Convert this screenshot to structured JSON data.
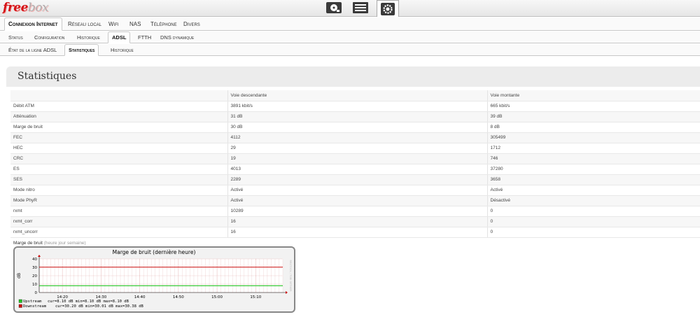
{
  "app": {
    "logo_main": "free",
    "logo_suffix": "box"
  },
  "top_icons": [
    "download-icon",
    "list-icon",
    "settings-icon"
  ],
  "tabs_level1": [
    {
      "label": "Connexion Internet",
      "active": true
    },
    {
      "label": "Réseau local",
      "active": false
    },
    {
      "label": "Wifi",
      "active": false
    },
    {
      "label": "NAS",
      "active": false
    },
    {
      "label": "Téléphone",
      "active": false
    },
    {
      "label": "Divers",
      "active": false
    }
  ],
  "tabs_level2": [
    {
      "label": "Status",
      "active": false
    },
    {
      "label": "Configuration",
      "active": false
    },
    {
      "label": "Historique",
      "active": false
    },
    {
      "label": "ADSL",
      "active": true
    },
    {
      "label": "FTTH",
      "active": false
    },
    {
      "label": "DNS dynamique",
      "active": false
    }
  ],
  "tabs_level3": [
    {
      "label": "État de la ligne ADSL",
      "active": false
    },
    {
      "label": "Statistiques",
      "active": true
    },
    {
      "label": "Historique",
      "active": false
    }
  ],
  "panel": {
    "title": "Statistiques"
  },
  "stats": {
    "headers": [
      "",
      "Voie descendante",
      "Voie montante"
    ],
    "rows": [
      [
        "Débit ATM",
        "3891 kbit/s",
        "665 kbit/s"
      ],
      [
        "Atténuation",
        "31 dB",
        "39 dB"
      ],
      [
        "Marge de bruit",
        "30 dB",
        "8 dB"
      ],
      [
        "FEC",
        "4112",
        "305499"
      ],
      [
        "HEC",
        "29",
        "1712"
      ],
      [
        "CRC",
        "19",
        "746"
      ],
      [
        "ES",
        "4013",
        "37280"
      ],
      [
        "SES",
        "2289",
        "3658"
      ],
      [
        "Mode nitro",
        "Activé",
        "Activé"
      ],
      [
        "Mode PhyR",
        "Activé",
        "Désactivé"
      ],
      [
        "rxmt",
        "10289",
        "0"
      ],
      [
        "rxmt_corr",
        "16",
        "0"
      ],
      [
        "rxmt_uncorr",
        "16",
        "0"
      ]
    ]
  },
  "graph": {
    "label": "Marge de bruit",
    "label_links": "(heure jour semaine)",
    "watermark": "RRDTOOL / TOBI OETIKER"
  },
  "chart_data": {
    "type": "line",
    "title": "Marge de bruit (dernière heure)",
    "ylabel": "dB",
    "ylim": [
      0,
      40
    ],
    "yticks": [
      "0",
      "10",
      "20",
      "30",
      "40"
    ],
    "xlim": [
      "14:14",
      "15:17"
    ],
    "xticks": [
      "14:20",
      "14:30",
      "14:40",
      "14:50",
      "15:00",
      "15:10"
    ],
    "grid": true,
    "legend_position": "bottom-left",
    "series": [
      {
        "name": "Upstream",
        "color": "#22c522",
        "x": [
          "14:14",
          "15:17"
        ],
        "values": [
          8.1,
          8.1
        ],
        "stats": "cur=8.10 dB   min=8.10 dB   max=8.10 dB"
      },
      {
        "name": "Downstream",
        "color": "#cc1111",
        "x": [
          "14:14",
          "15:17"
        ],
        "values": [
          30.2,
          30.2
        ],
        "stats": "cur=30.20 dB   min=30.01 dB   max=30.38 dB"
      }
    ]
  }
}
